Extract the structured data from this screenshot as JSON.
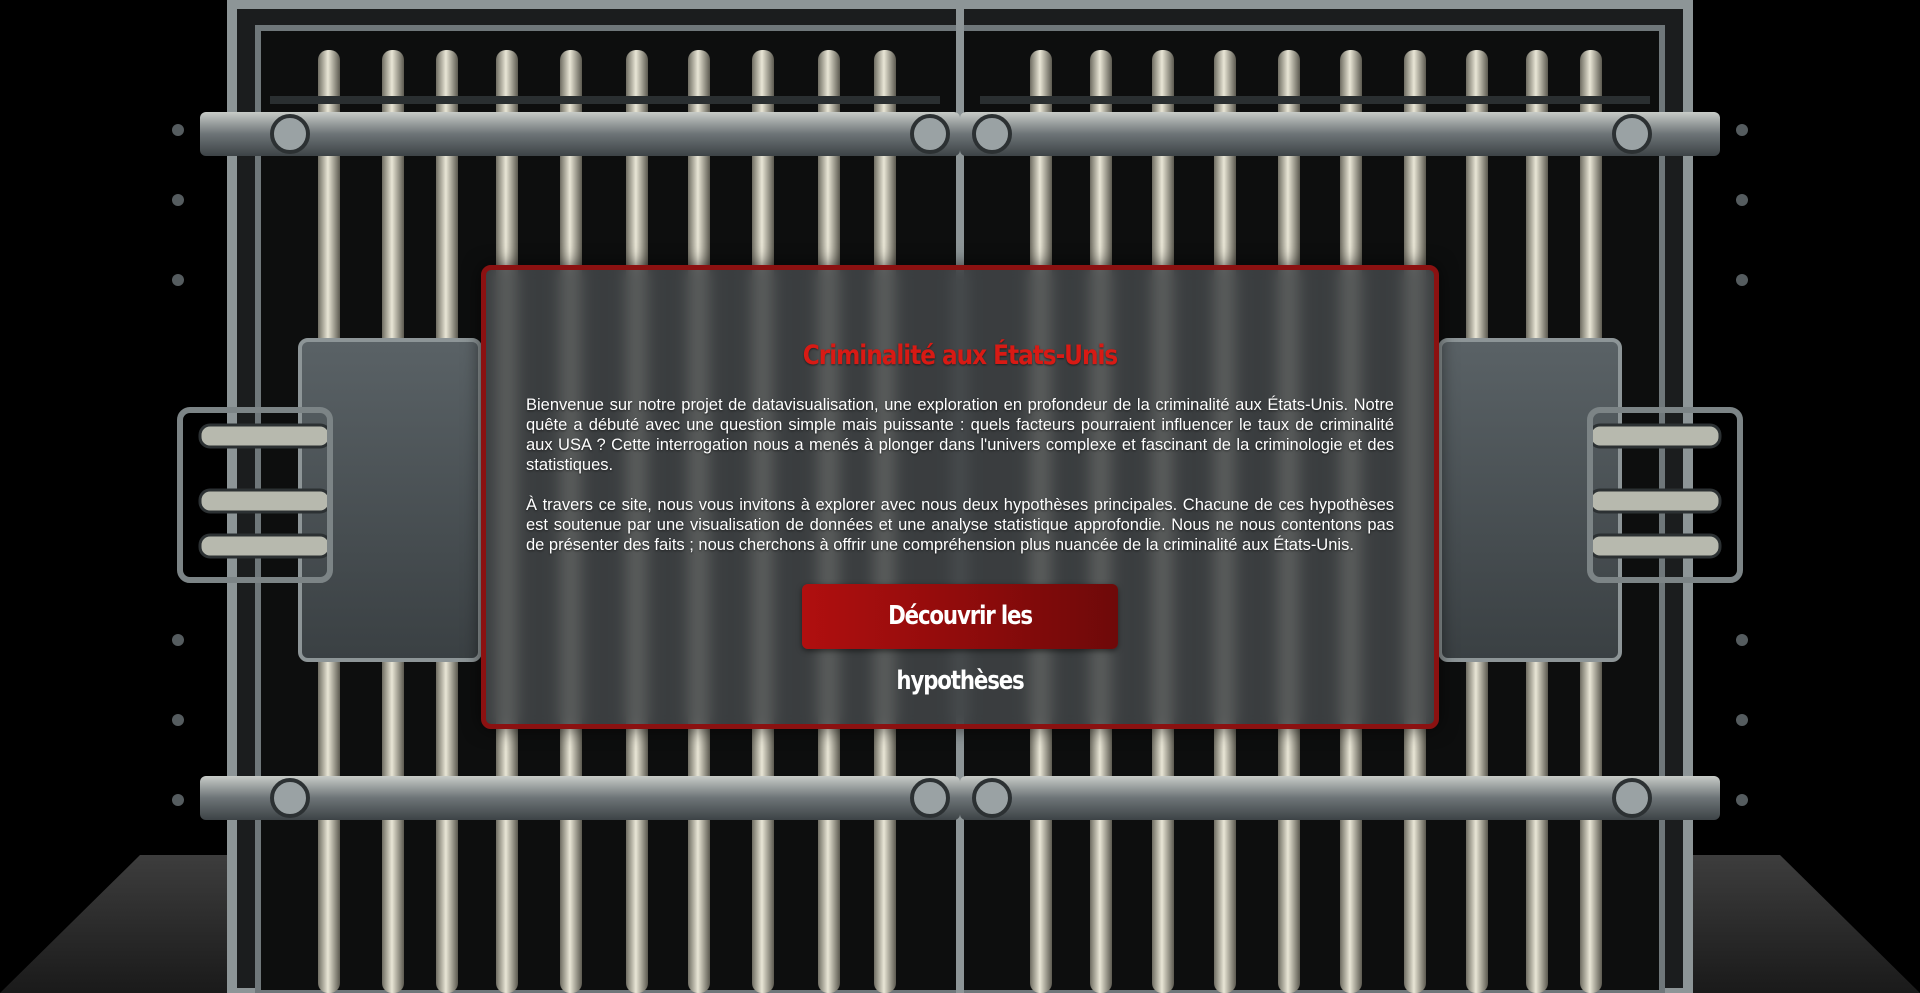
{
  "hero": {
    "title": "Criminalité aux États-Unis",
    "paragraphs": [
      "Bienvenue sur notre projet de datavisualisation, une exploration en profondeur de la criminalité aux États-Unis. Notre quête a débuté avec une question simple mais puissante : quels facteurs pourraient influencer le taux de criminalité aux USA ? Cette interrogation nous a menés à plonger dans l'univers complexe et fascinant de la criminologie et des statistiques.",
      "À travers ce site, nous vous invitons à explorer avec nous deux hypothèses principales. Chacune de ces hypothèses est soutenue par une visualisation de données et une analyse statistique approfondie. Nous ne nous contentons pas de présenter des faits ; nous cherchons à offrir une compréhension plus nuancée de la criminalité aux États-Unis."
    ],
    "cta_label": "Découvrir les hypothèses"
  },
  "background": {
    "icon": "jail-gate-illustration"
  },
  "colors": {
    "accent": "#d81a14",
    "button": "#a50e0e",
    "border": "#8b1111",
    "background": "#000000"
  }
}
